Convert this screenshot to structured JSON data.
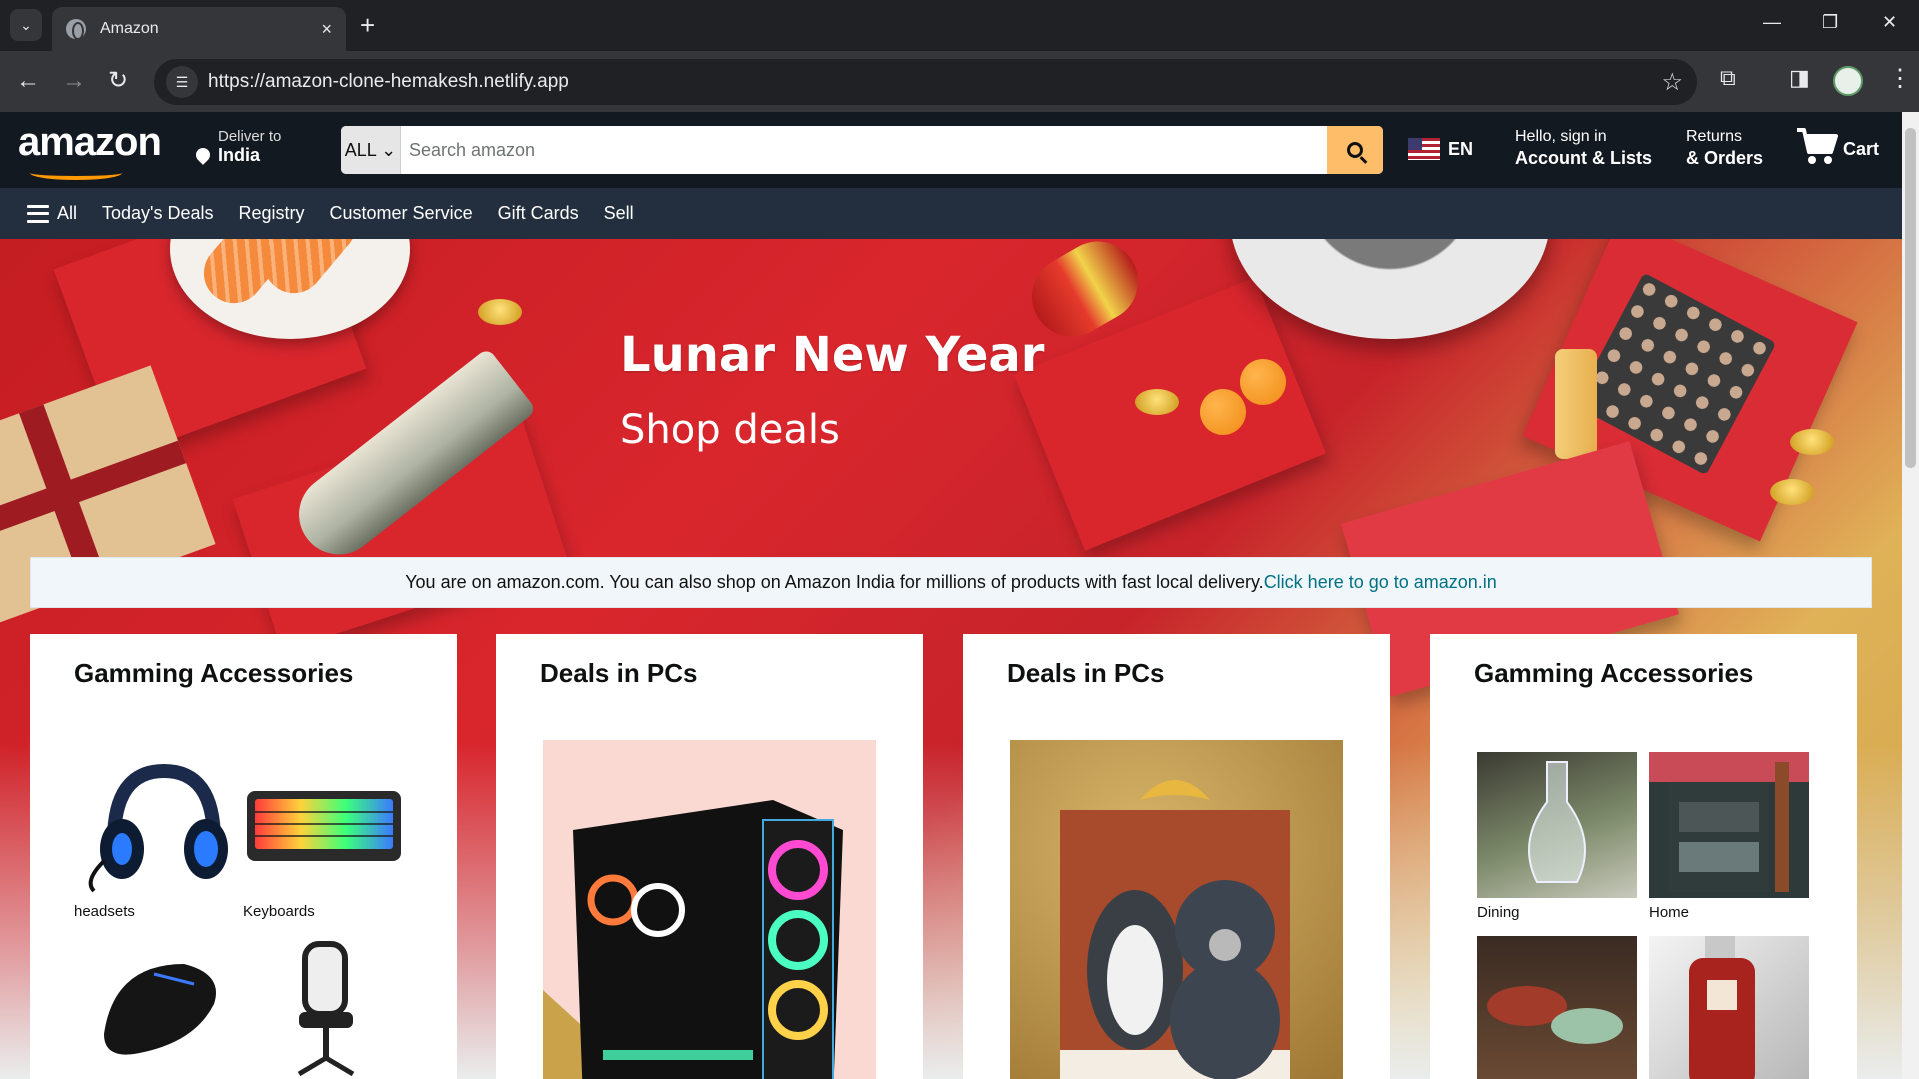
{
  "browser": {
    "tab_title": "Amazon",
    "tab_close": "×",
    "new_tab": "+",
    "url": "https://amazon-clone-hemakesh.netlify.app",
    "win_minimize": "—",
    "win_restore": "❐",
    "win_close": "✕"
  },
  "header": {
    "logo": "amazon",
    "deliver_small": "Deliver to",
    "deliver_big": "India",
    "search_category": "ALL ⌄",
    "search_placeholder": "Search amazon",
    "lang": "EN",
    "account_l1": "Hello, sign in",
    "account_l2": "Account & Lists",
    "returns_l1": "Returns",
    "returns_l2": "& Orders",
    "cart": "Cart"
  },
  "subnav": {
    "all": "All",
    "items": [
      "Today's Deals",
      "Registry",
      "Customer Service",
      "Gift Cards",
      "Sell"
    ]
  },
  "hero": {
    "title": "Lunar New Year",
    "subtitle": "Shop deals"
  },
  "notice": {
    "text": "You are on amazon.com. You can also shop on Amazon India for millions of products with fast local delivery.",
    "link": "Click here to go to amazon.in"
  },
  "cards": [
    {
      "title": "Gamming Accessories",
      "items": [
        "headsets",
        "Keyboards"
      ]
    },
    {
      "title": "Deals in PCs"
    },
    {
      "title": "Deals in PCs"
    },
    {
      "title": "Gamming Accessories",
      "items": [
        "Dining",
        "Home"
      ]
    }
  ],
  "colors": {
    "header_bg": "#131921",
    "subnav_bg": "#232f3e",
    "search_button": "#febd69",
    "accent": "#ff9900",
    "link": "#007185"
  }
}
